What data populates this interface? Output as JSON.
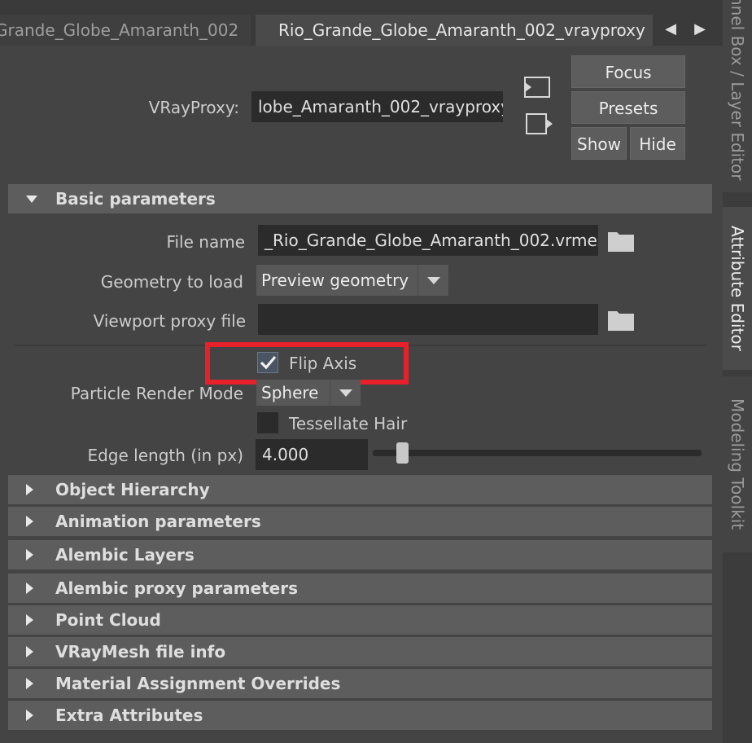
{
  "tabs": {
    "inactive": "Grande_Globe_Amaranth_002",
    "active": "Rio_Grande_Globe_Amaranth_002_vrayproxy"
  },
  "side_tabs": {
    "channel_box": "nnel Box / Layer Editor",
    "attribute_editor": "Attribute Editor",
    "modeling_toolkit": "Modeling Toolkit"
  },
  "proxy": {
    "label": "VRayProxy:",
    "value": "lobe_Amaranth_002_vrayproxy",
    "focus": "Focus",
    "presets": "Presets",
    "show": "Show",
    "hide": "Hide"
  },
  "basic": {
    "title": "Basic parameters",
    "file_name_label": "File name",
    "file_name_value": "_Rio_Grande_Globe_Amaranth_002.vrmesh",
    "geometry_label": "Geometry to load",
    "geometry_value": "Preview geometry",
    "viewport_label": "Viewport proxy file",
    "viewport_value": "",
    "flip_axis_label": "Flip Axis",
    "flip_axis_checked": true,
    "particle_label": "Particle Render Mode",
    "particle_value": "Sphere",
    "tessellate_label": "Tessellate Hair",
    "tessellate_checked": false,
    "edge_label": "Edge length (in px)",
    "edge_value": "4.000"
  },
  "sections": [
    "Object Hierarchy",
    "Animation parameters",
    "Alembic Layers",
    "Alembic proxy parameters",
    "Point Cloud",
    "VRayMesh file info",
    "Material Assignment Overrides",
    "Extra Attributes"
  ],
  "colors": {
    "highlight": "#e8202a"
  }
}
